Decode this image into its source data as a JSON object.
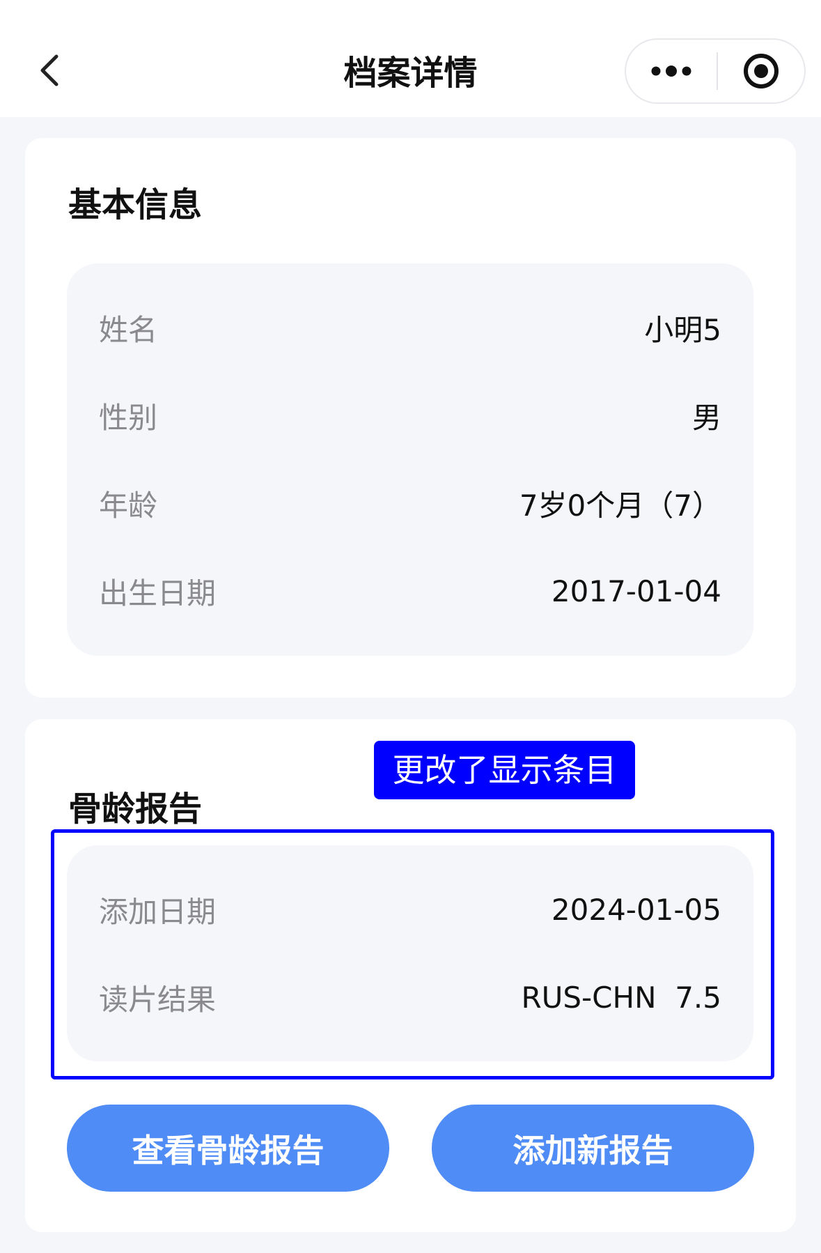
{
  "navbar": {
    "title": "档案详情"
  },
  "basic_info": {
    "title": "基本信息",
    "rows": [
      {
        "label": "姓名",
        "value": "小明5"
      },
      {
        "label": "性别",
        "value": "男"
      },
      {
        "label": "年龄",
        "value": "7岁0个月（7）"
      },
      {
        "label": "出生日期",
        "value": "2017-01-04"
      }
    ]
  },
  "bone_age_report": {
    "title": "骨龄报告",
    "annotation": "更改了显示条目",
    "rows": [
      {
        "label": "添加日期",
        "value": "2024-01-05"
      },
      {
        "label": "读片结果",
        "value": "RUS-CHN  7.5"
      }
    ],
    "view_button": "查看骨龄报告",
    "add_button": "添加新报告"
  },
  "colors": {
    "primary_button": "#4f8cf5",
    "annotation": "#0000ff",
    "page_background": "#f5f6fa"
  },
  "icons": {
    "back": "chevron-left-icon",
    "more": "more-dots-icon",
    "close": "target-circle-icon"
  }
}
